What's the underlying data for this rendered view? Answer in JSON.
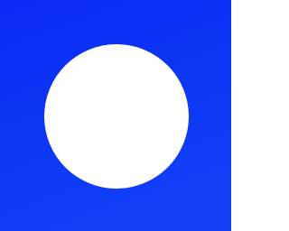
{
  "colors": {
    "background": "#0f3af5",
    "circle": "#ffffff"
  }
}
